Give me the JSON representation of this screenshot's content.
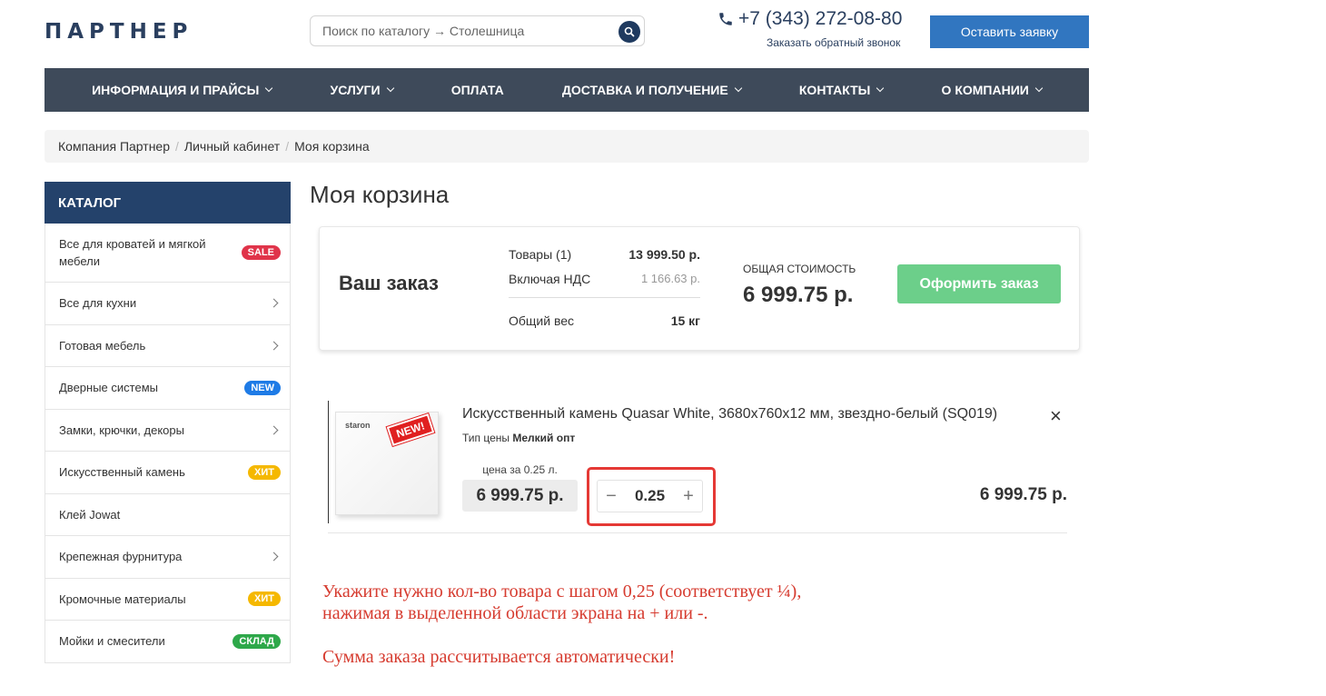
{
  "header": {
    "logo": "ПАРТНЕР",
    "search_placeholder": "Поиск по каталогу → Столешница",
    "phone": "+7 (343) 272-08-80",
    "callback": "Заказать обратный звонок",
    "request_button": "Оставить заявку",
    "accent_color": "#3176c0"
  },
  "nav": {
    "items": [
      {
        "label": "Информация и прайсы",
        "has_dropdown": true
      },
      {
        "label": "Услуги",
        "has_dropdown": true
      },
      {
        "label": "Оплата",
        "has_dropdown": false
      },
      {
        "label": "Доставка и получение",
        "has_dropdown": true
      },
      {
        "label": "Контакты",
        "has_dropdown": true
      },
      {
        "label": "О компании",
        "has_dropdown": true
      }
    ]
  },
  "breadcrumb": [
    "Компания Партнер",
    "Личный кабинет",
    "Моя корзина"
  ],
  "sidebar": {
    "title": "Каталог",
    "items": [
      {
        "label": "Все для кроватей и мягкой мебели",
        "badge": "SALE",
        "badge_color": "#e0344a"
      },
      {
        "label": "Все для кухни",
        "arrow": true
      },
      {
        "label": "Готовая мебель",
        "arrow": true
      },
      {
        "label": "Дверные системы",
        "badge": "NEW",
        "badge_color": "#1e7be6"
      },
      {
        "label": "Замки, крючки, декоры",
        "arrow": true
      },
      {
        "label": "Искусственный камень",
        "badge": "ХИТ",
        "badge_color": "#f5b800"
      },
      {
        "label": "Клей Jowat"
      },
      {
        "label": "Крепежная фурнитура",
        "arrow": true
      },
      {
        "label": "Кромочные материалы",
        "badge": "ХИТ",
        "badge_color": "#f5b800"
      },
      {
        "label": "Мойки и смесители",
        "badge": "СКЛАД",
        "badge_color": "#2ea84a"
      }
    ]
  },
  "page": {
    "title": "Моя корзина"
  },
  "order": {
    "title": "Ваш заказ",
    "items_label": "Товары (1)",
    "items_value": "13 999.50 р.",
    "vat_label": "Включая НДС",
    "vat_value": "1 166.63 р.",
    "weight_label": "Общий вес",
    "weight_value": "15 кг",
    "total_label": "Общая стоимость",
    "total_value": "6 999.75 р.",
    "checkout_button": "Оформить заказ",
    "checkout_color": "#6ccf8a"
  },
  "cart_item": {
    "name": "Искусственный камень Quasar White, 3680x760x12 мм, звездно-белый (SQ019)",
    "price_type_label": "Тип цены",
    "price_type_value": "Мелкий опт",
    "brand": "staron",
    "new_badge": "NEW!",
    "unit_label": "цена за 0.25 л.",
    "unit_price": "6 999.75 р.",
    "quantity": "0.25",
    "minus": "−",
    "plus": "+",
    "line_total": "6 999.75 р.",
    "remove": "×"
  },
  "note": {
    "line1": "Укажите нужно кол-во товара с шагом 0,25 (соответствует ¼),",
    "line2": "нажимая в выделенной области экрана на + или -.",
    "line3": "Сумма заказа рассчитывается автоматически!",
    "color": "#d63b2f"
  }
}
